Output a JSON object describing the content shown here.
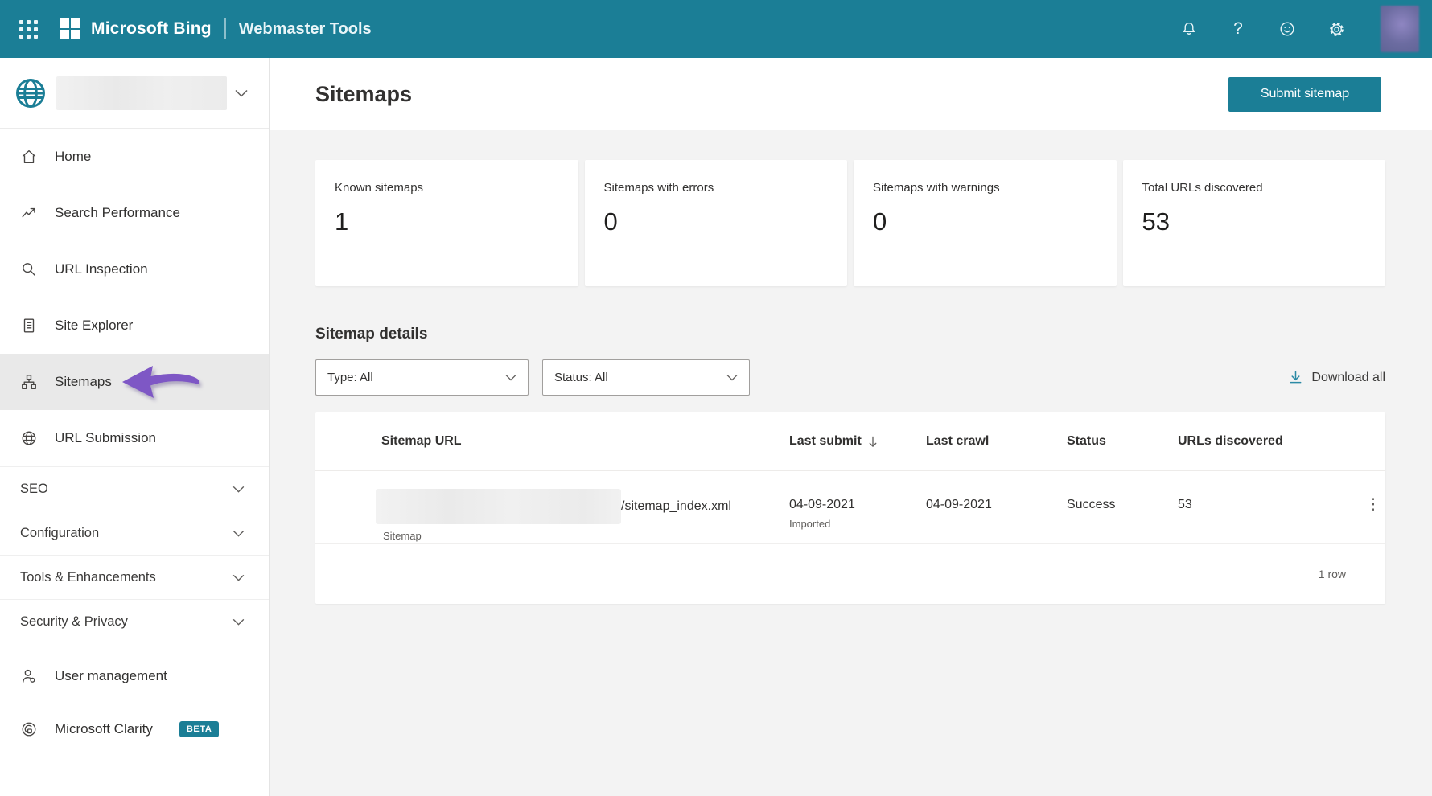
{
  "topbar": {
    "brand": "Microsoft Bing",
    "product": "Webmaster Tools",
    "help_glyph": "?",
    "kebab_glyph": "⋮",
    "accent_color": "#1b7e96"
  },
  "sidebar": {
    "nav": [
      {
        "label": "Home",
        "icon": "home-icon"
      },
      {
        "label": "Search Performance",
        "icon": "trend-icon"
      },
      {
        "label": "URL Inspection",
        "icon": "search-icon"
      },
      {
        "label": "Site Explorer",
        "icon": "document-icon"
      },
      {
        "label": "Sitemaps",
        "icon": "sitemap-icon",
        "active": true
      },
      {
        "label": "URL Submission",
        "icon": "globe-icon"
      }
    ],
    "sections": [
      {
        "label": "SEO"
      },
      {
        "label": "Configuration"
      },
      {
        "label": "Tools & Enhancements"
      },
      {
        "label": "Security & Privacy"
      }
    ],
    "bottom": [
      {
        "label": "User management",
        "icon": "user-icon"
      },
      {
        "label": "Microsoft Clarity",
        "icon": "clarity-icon",
        "badge": "BETA"
      }
    ],
    "annotation_arrow_color": "#7e57c5"
  },
  "page": {
    "title": "Sitemaps",
    "submit_button": "Submit sitemap"
  },
  "stats": [
    {
      "label": "Known sitemaps",
      "value": "1"
    },
    {
      "label": "Sitemaps with errors",
      "value": "0"
    },
    {
      "label": "Sitemaps with warnings",
      "value": "0"
    },
    {
      "label": "Total URLs discovered",
      "value": "53"
    }
  ],
  "details": {
    "heading": "Sitemap details",
    "type_filter": "Type: All",
    "status_filter": "Status: All",
    "download_all": "Download all"
  },
  "table": {
    "columns": [
      "Sitemap URL",
      "Last submit",
      "Last crawl",
      "Status",
      "URLs discovered"
    ],
    "rows": [
      {
        "url_suffix": "/sitemap_index.xml",
        "url_note": "Sitemap",
        "last_submit": "04-09-2021",
        "last_submit_note": "Imported",
        "last_crawl": "04-09-2021",
        "status": "Success",
        "urls_discovered": "53"
      }
    ],
    "footer": "1 row"
  }
}
